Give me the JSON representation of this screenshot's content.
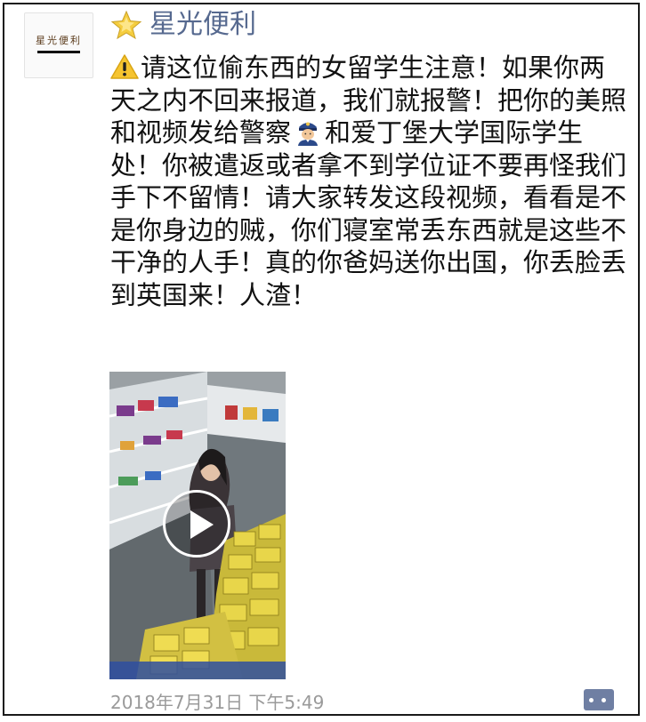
{
  "post": {
    "account_name": "星光便利",
    "avatar_text": "星光便利",
    "message_part1": "请这位偷东西的女留学生注意！如果你两天之内不回来报道，我们就报警！把你的美照和视频发给警察",
    "message_part2": "和爱丁堡大学国际学生处！你被遣返或者拿不到学位证不要再怪我们手下不留情！请大家转发这段视频，看看是不是你身边的贼，你们寝室常丢东西就是这些不干净的人手！真的你爸妈送你出国，你丢脸丢到英国来！人渣！",
    "timestamp": "2018年7月31日 下午5:49"
  },
  "icons": {
    "name_badge": "star-icon",
    "warning": "warning-icon",
    "police": "police-officer-icon",
    "play": "play-icon",
    "comment": "comment-icon"
  },
  "colors": {
    "account_name": "#56698f",
    "timestamp": "#9a9a9a",
    "comment_button": "#6f7fa3"
  }
}
